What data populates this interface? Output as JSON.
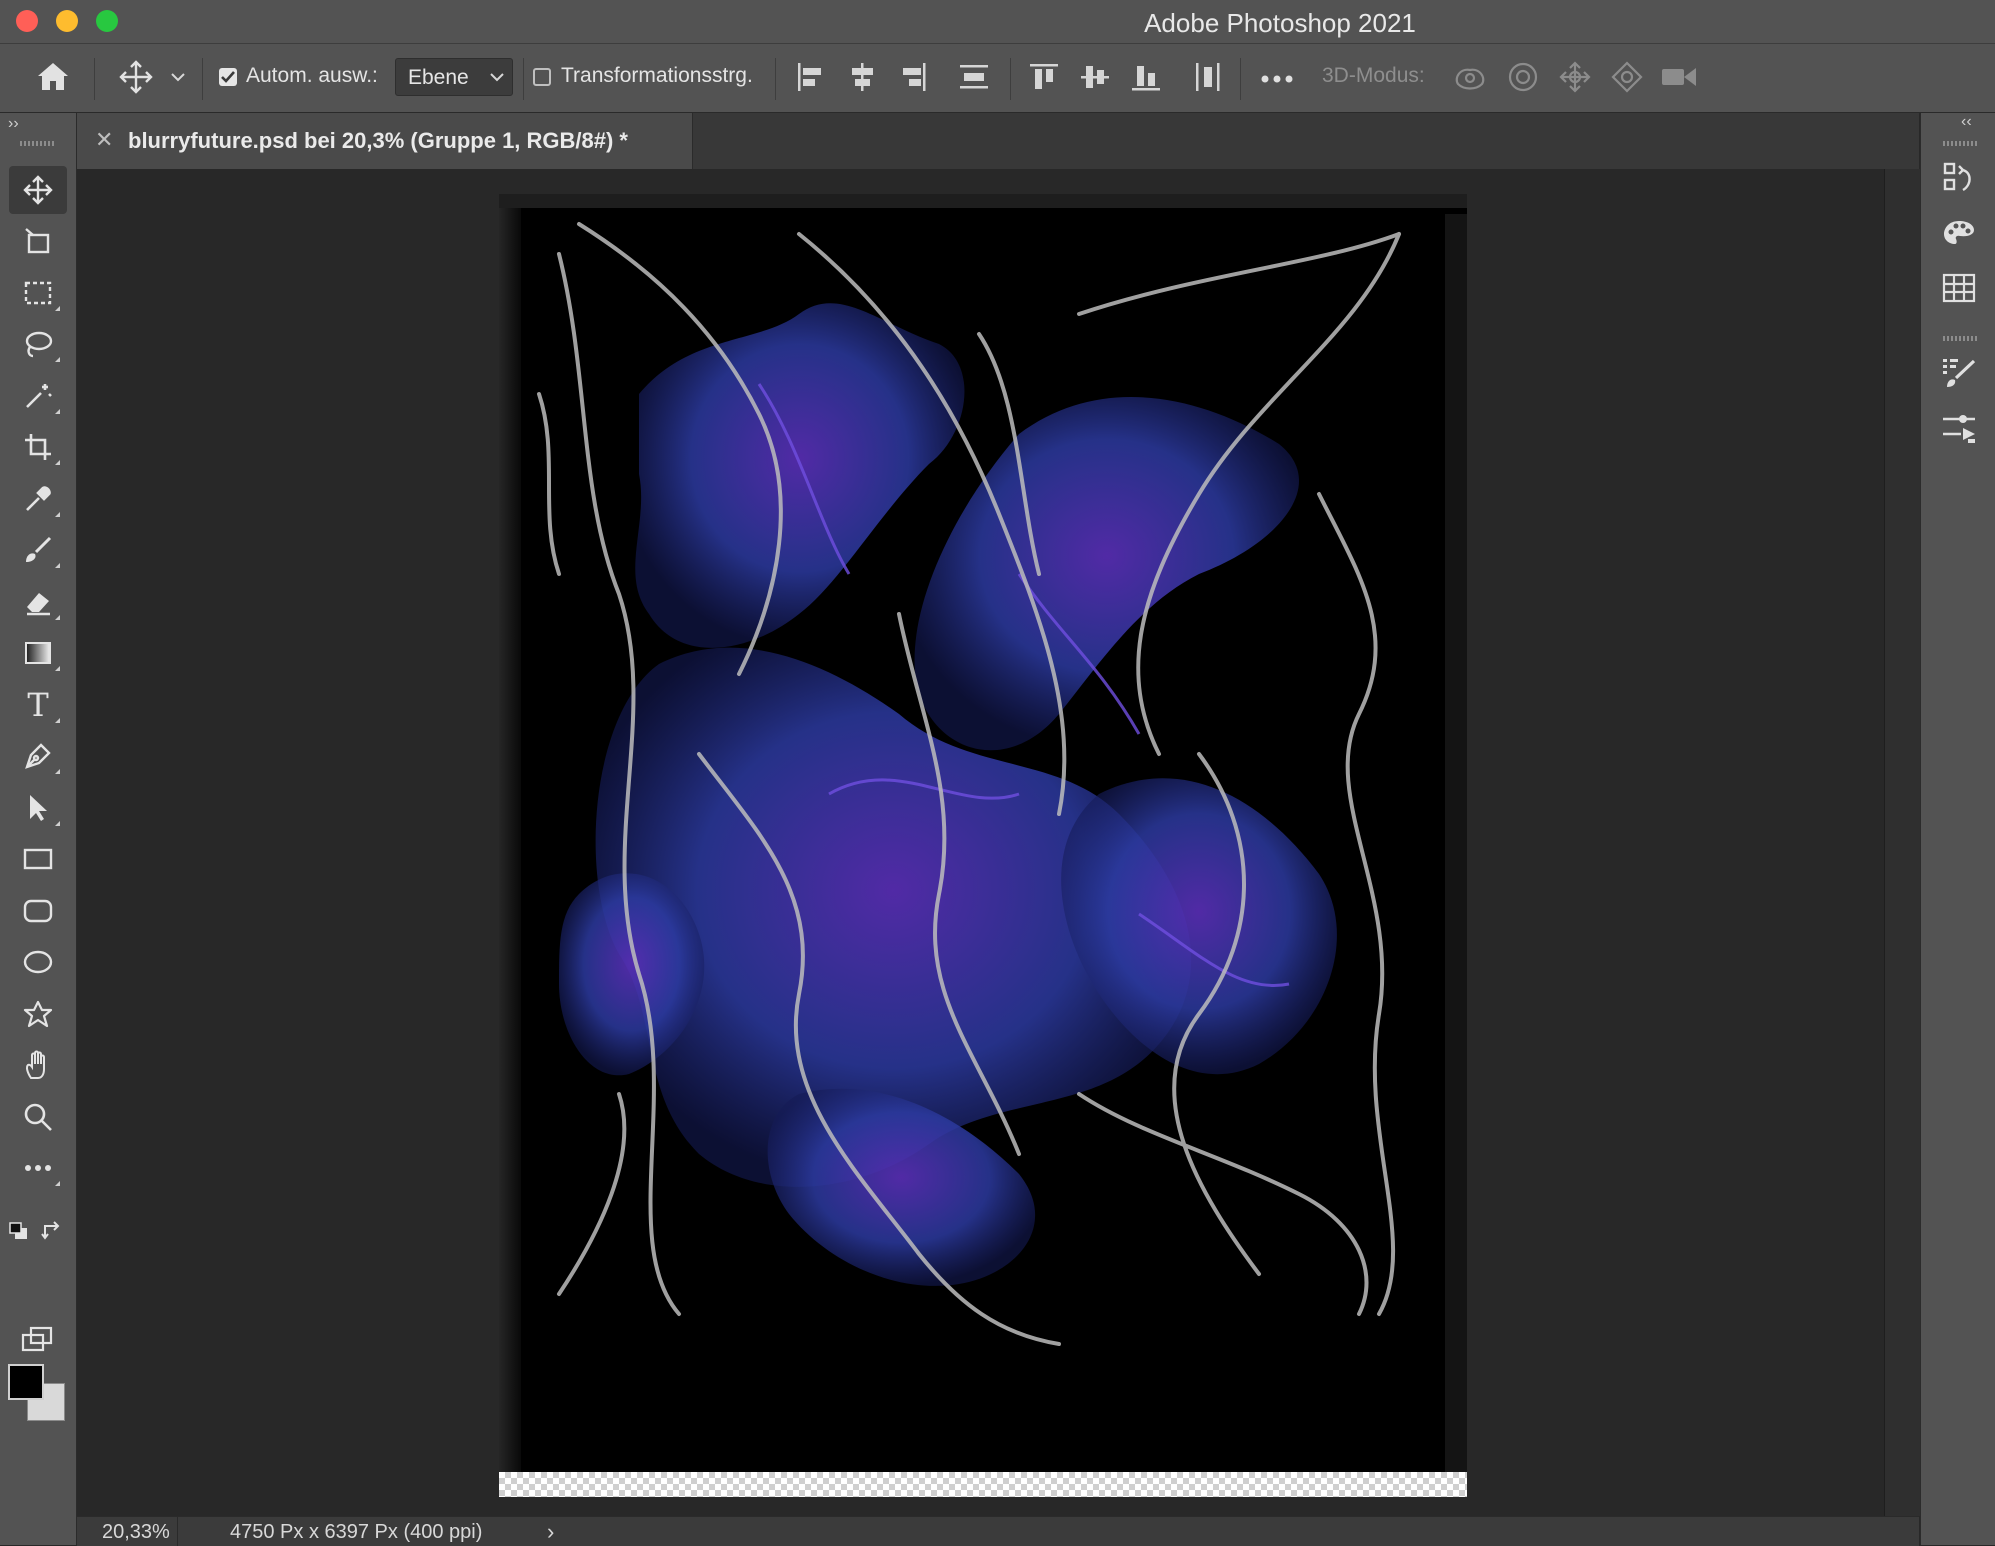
{
  "window": {
    "title": "Adobe Photoshop 2021",
    "traffic_colors": {
      "close": "#ff5f57",
      "minimize": "#febc2e",
      "zoom": "#28c840"
    }
  },
  "options_bar": {
    "auto_select_label": "Autom. ausw.:",
    "auto_select_checked": true,
    "auto_select_target": "Ebene",
    "transform_controls_label": "Transformationsstrg.",
    "transform_controls_checked": false,
    "mode_3d_label": "3D-Modus:"
  },
  "document": {
    "tab_title": "blurryfuture.psd bei 20,3% (Gruppe 1, RGB/8#) *",
    "zoom": "20,33%",
    "dimensions": "4750 Px x 6397 Px (400 ppi)",
    "status_expand": "›"
  },
  "tools": [
    "move-tool",
    "artboard-tool",
    "marquee-tool",
    "lasso-tool",
    "magic-wand-tool",
    "crop-tool",
    "eyedropper-tool",
    "brush-tool",
    "eraser-tool",
    "gradient-tool",
    "type-tool",
    "pen-tool",
    "path-selection-tool",
    "rectangle-tool",
    "rounded-rectangle-tool",
    "ellipse-tool",
    "custom-shape-tool",
    "hand-tool",
    "zoom-tool",
    "more-tools"
  ],
  "colors": {
    "foreground": "#000000",
    "background": "#d9d9d9",
    "artwork_blue": "#2c3aa0",
    "artwork_violet": "#5a2fb8"
  },
  "collapse_left": "››",
  "collapse_right": "‹‹",
  "type_tool_glyph": "T"
}
